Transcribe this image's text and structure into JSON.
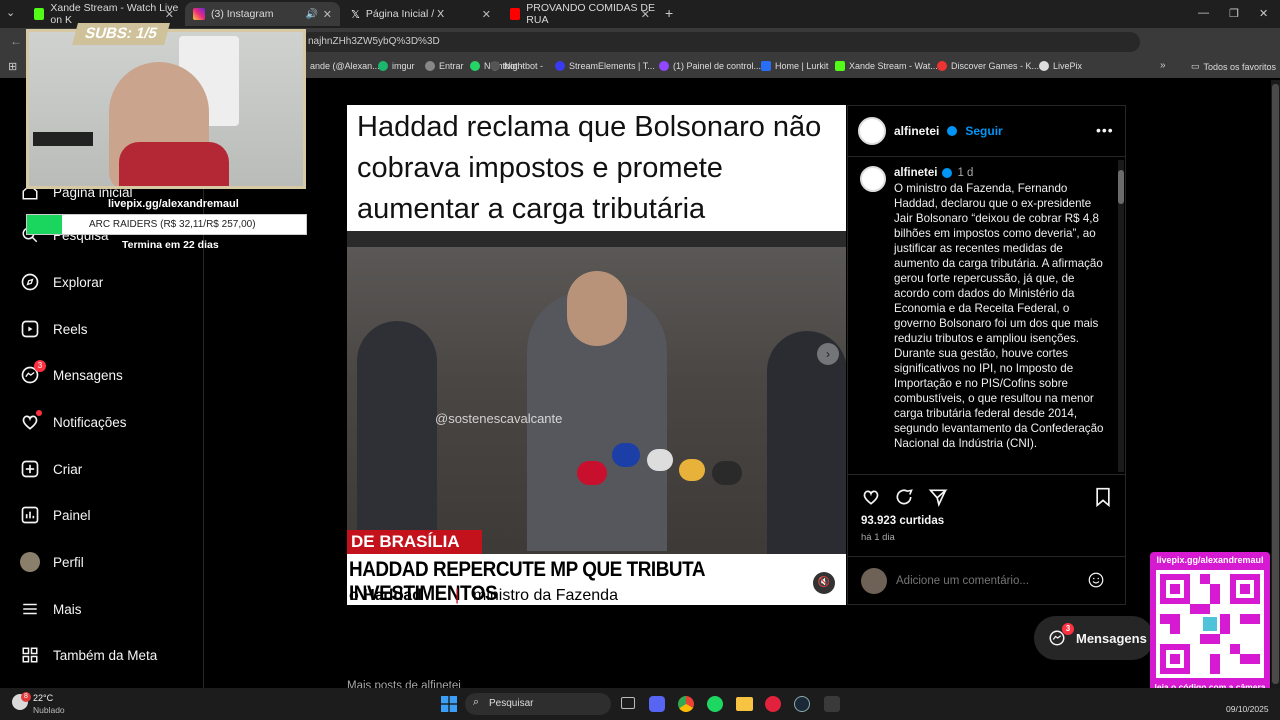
{
  "tabs": [
    {
      "label": "Xande Stream - Watch Live on K"
    },
    {
      "label": "(3) Instagram",
      "active": true
    },
    {
      "label": "Página Inicial / X"
    },
    {
      "label": "PROVANDO COMIDAS DE RUA"
    }
  ],
  "url": "najhnZHh3ZW5ybQ%3D%3D",
  "bookmarks": [
    "ande (@Alexan...",
    "imgur",
    "Entrar",
    "Nightbot -",
    "StreamElements | T...",
    "(1) Painel de control...",
    "Home | Lurkit",
    "Xande Stream - Wat...",
    "Discover Games - K...",
    "LivePix",
    "Todos os favoritos"
  ],
  "overlay": {
    "subs": "SUBS: 1/5",
    "livepix_url": "livepix.gg/alexandremaul",
    "goal": "ARC RAIDERS (R$ 32,11/R$ 257,00)",
    "goal_progress": 0.125,
    "goal_ends": "Termina em 22 dias",
    "qr_title": "livepix.gg/alexandremaul",
    "qr_caption": "leia o código com a câmera do celular."
  },
  "sidebar": {
    "items": [
      {
        "label": "Página inicial",
        "icon": "home-icon"
      },
      {
        "label": "Pesquisa",
        "icon": "search-icon"
      },
      {
        "label": "Explorar",
        "icon": "compass-icon"
      },
      {
        "label": "Reels",
        "icon": "reels-icon"
      },
      {
        "label": "Mensagens",
        "icon": "messenger-icon",
        "badge": "3"
      },
      {
        "label": "Notificações",
        "icon": "heart-icon"
      },
      {
        "label": "Criar",
        "icon": "plus-square-icon"
      },
      {
        "label": "Painel",
        "icon": "chart-icon"
      },
      {
        "label": "Perfil",
        "icon": "avatar"
      },
      {
        "label": "Mais",
        "icon": "menu-icon"
      },
      {
        "label": "Também da Meta",
        "icon": "meta-icon"
      }
    ]
  },
  "post": {
    "headline": "Haddad reclama que Bolsonaro não cobrava impostos e promete aumentar a carga tributária",
    "watermark": "@sostenescavalcante",
    "ticker_top": "DE BRASÍLIA",
    "ticker_main": "HADDAD REPERCUTE MP QUE TRIBUTA INVESTIMENTOS",
    "ticker_name": "o Haddad",
    "ticker_role": "ministro da Fazenda",
    "username": "alfinetei",
    "follow": "Seguir",
    "time": "1 d",
    "caption": "O ministro da Fazenda, Fernando Haddad, declarou que o ex-presidente Jair Bolsonaro “deixou de cobrar R$ 4,8 bilhões em impostos como deveria”, ao justificar as recentes medidas de aumento da carga tributária. A afirmação gerou forte repercussão, já que, de acordo com dados do Ministério da Economia e da Receita Federal, o governo Bolsonaro foi um dos que mais reduziu tributos e ampliou isenções. Durante sua gestão, houve cortes significativos no IPI, no Imposto de Importação e no PIS/Cofins sobre combustíveis, o que resultou na menor carga tributária federal desde 2014, segundo levantamento da Confederação Nacional da Indústria (CNI).",
    "likes": "93.923 curtidas",
    "posted": "há 1 dia",
    "comment_placeholder": "Adicione um comentário...",
    "more_posts": "Mais posts de alfinetei"
  },
  "messages_button": {
    "label": "Mensagens",
    "badge": "3"
  },
  "taskbar": {
    "weather_temp": "22°C",
    "weather_desc": "Nublado",
    "weather_badge": "8",
    "search": "Pesquisar",
    "date": "09/10/2025"
  },
  "colors": {
    "accent": "#0095f6",
    "badge": "#ff3040",
    "cnn_red": "#c4121c",
    "livepix_pink": "#d51ad1"
  }
}
